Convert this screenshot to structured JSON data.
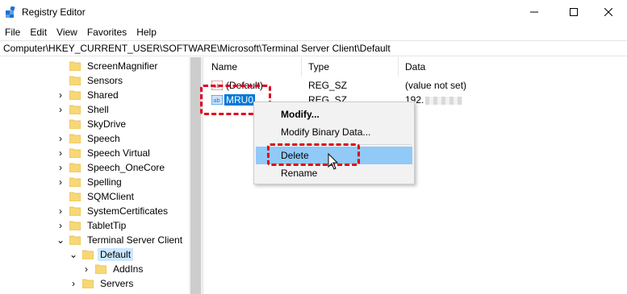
{
  "window": {
    "title": "Registry Editor",
    "controls": {
      "minimize": "—",
      "maximize": "☐",
      "close": "✕"
    }
  },
  "menu": [
    "File",
    "Edit",
    "View",
    "Favorites",
    "Help"
  ],
  "address": "Computer\\HKEY_CURRENT_USER\\SOFTWARE\\Microsoft\\Terminal Server Client\\Default",
  "tree": {
    "items": [
      {
        "label": "ScreenMagnifier",
        "chevron": ""
      },
      {
        "label": "Sensors",
        "chevron": ""
      },
      {
        "label": "Shared",
        "chevron": "›"
      },
      {
        "label": "Shell",
        "chevron": "›"
      },
      {
        "label": "SkyDrive",
        "chevron": ""
      },
      {
        "label": "Speech",
        "chevron": "›"
      },
      {
        "label": "Speech Virtual",
        "chevron": "›"
      },
      {
        "label": "Speech_OneCore",
        "chevron": "›"
      },
      {
        "label": "Spelling",
        "chevron": "›"
      },
      {
        "label": "SQMClient",
        "chevron": ""
      },
      {
        "label": "SystemCertificates",
        "chevron": "›"
      },
      {
        "label": "TabletTip",
        "chevron": "›"
      },
      {
        "label": "Terminal Server Client",
        "chevron": "⌄"
      },
      {
        "label": "Default",
        "chevron": "⌄",
        "selected": true
      },
      {
        "label": "AddIns",
        "chevron": "›"
      },
      {
        "label": "Servers",
        "chevron": "›"
      }
    ]
  },
  "values": {
    "columns": [
      "Name",
      "Type",
      "Data"
    ],
    "rows": [
      {
        "name": "(Default)",
        "type": "REG_SZ",
        "data": "(value not set)"
      },
      {
        "name": "MRU0",
        "type": "REG_SZ",
        "data": "192."
      }
    ]
  },
  "context_menu": {
    "items": [
      "Modify...",
      "Modify Binary Data...",
      "Delete",
      "Rename"
    ]
  },
  "colors": {
    "highlight_dash": "#e0001b",
    "selection_blue": "#0078d7",
    "menu_hover": "#91c9f7",
    "folder_yellow": "#f8d775"
  }
}
